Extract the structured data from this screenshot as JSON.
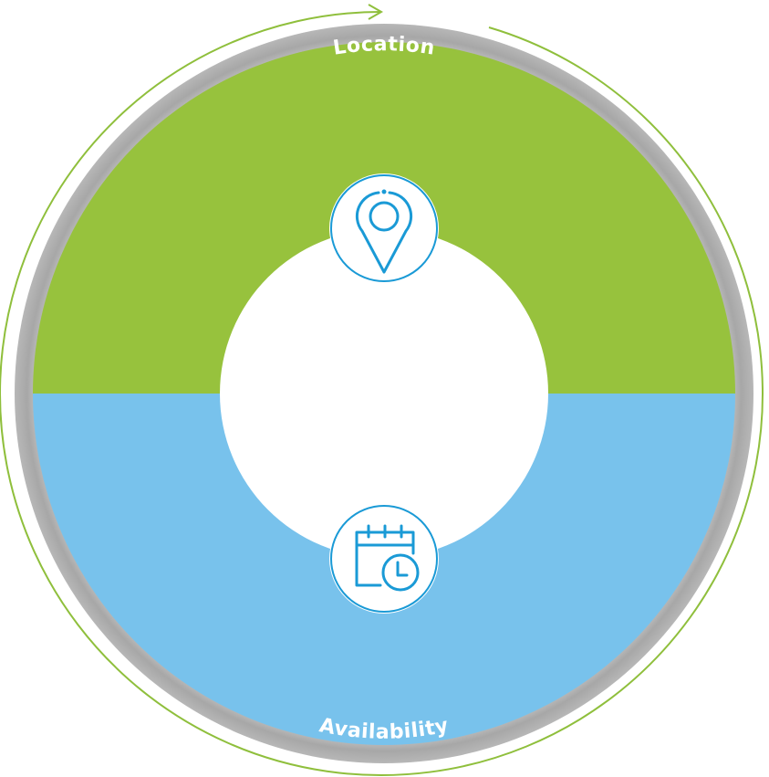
{
  "segments": [
    {
      "label": "Location",
      "color": "#97c23d",
      "icon": "location-pin-icon"
    },
    {
      "label": "Availability",
      "color": "#78c2ec",
      "icon": "calendar-clock-icon"
    }
  ],
  "colors": {
    "outer_arrow": "#8fbf3c",
    "shadow": "#9a9a9a",
    "icon_stroke": "#1a9ad6",
    "center": "#ffffff",
    "label_text": "#ffffff"
  }
}
